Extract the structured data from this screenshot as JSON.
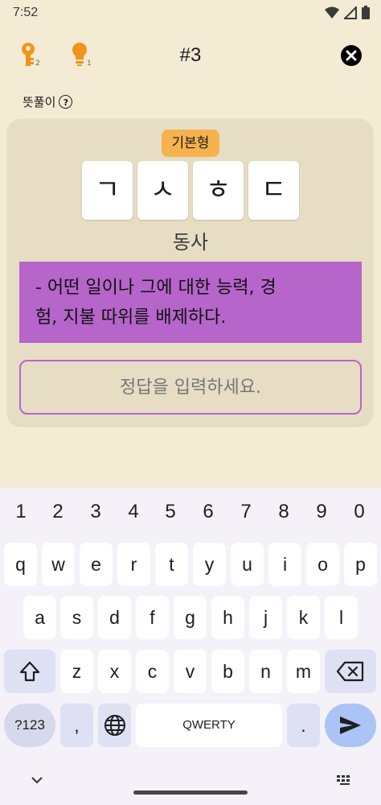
{
  "status": {
    "time": "7:52"
  },
  "header": {
    "key_hint_count": "2",
    "bulb_hint_count": "1",
    "puzzle_number": "#3"
  },
  "section": {
    "label": "뜻풀이",
    "help_symbol": "?"
  },
  "card": {
    "tag": "기본형",
    "tiles": [
      "ㄱ",
      "ㅅ",
      "ㅎ",
      "ㄷ"
    ],
    "part_of_speech": "동사",
    "definition_line1": "- 어떤 일이나 그에 대한 능력, 경",
    "definition_line2": "험, 지불 따위를 배제하다.",
    "answer_placeholder": "정답을 입력하세요."
  },
  "keyboard": {
    "numbers": [
      "1",
      "2",
      "3",
      "4",
      "5",
      "6",
      "7",
      "8",
      "9",
      "0"
    ],
    "row1": [
      "q",
      "w",
      "e",
      "r",
      "t",
      "y",
      "u",
      "i",
      "o",
      "p"
    ],
    "row2": [
      "a",
      "s",
      "d",
      "f",
      "g",
      "h",
      "j",
      "k",
      "l"
    ],
    "row3": [
      "z",
      "x",
      "c",
      "v",
      "b",
      "n",
      "m"
    ],
    "symbols_label": "?123",
    "comma": ",",
    "space_label": "QWERTY",
    "period": "."
  },
  "colors": {
    "background": "#f3ebd3",
    "card": "#e7ddc4",
    "accent_purple": "#b665cb",
    "tag_orange": "#f6b24e",
    "icon_orange": "#f0941c"
  }
}
